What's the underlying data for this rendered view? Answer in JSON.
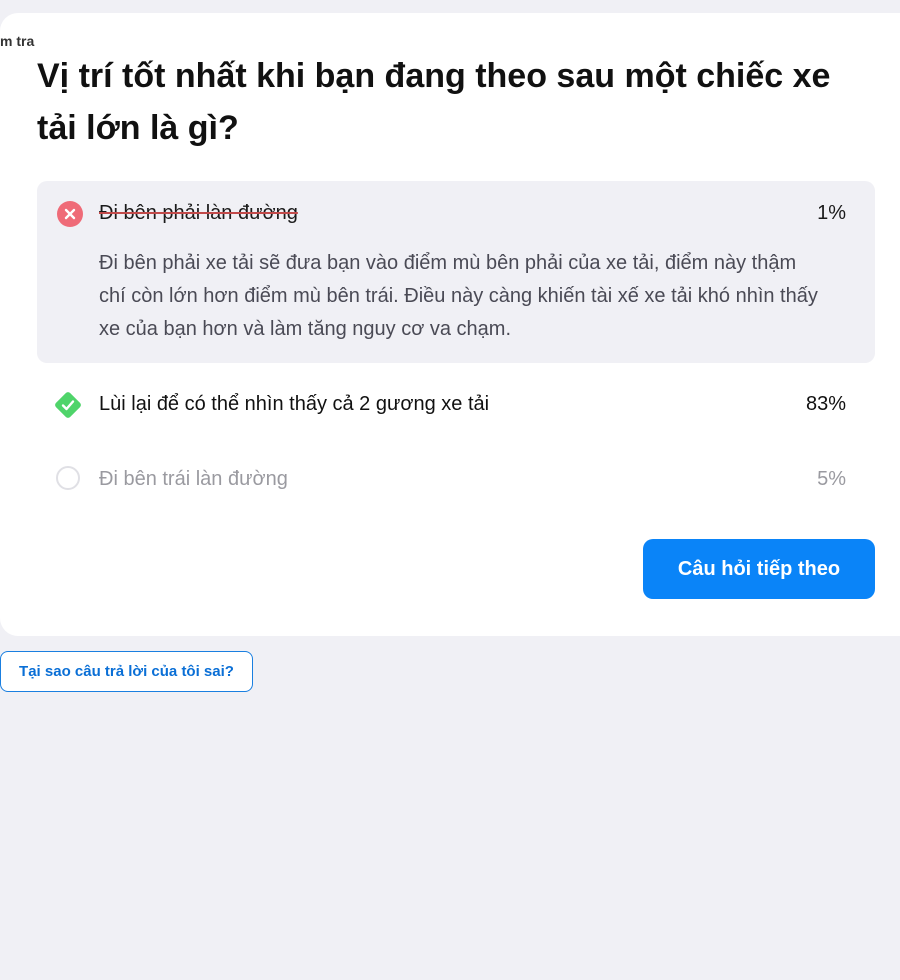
{
  "breadcrumb": "m tra",
  "question": "Vị trí tốt nhất khi bạn đang theo sau một chiếc xe tải lớn là gì?",
  "answers": [
    {
      "label": "Đi bên phải làn đường",
      "percent": "1%",
      "state": "wrong",
      "icon": "x-circle-icon",
      "explanation": "Đi bên phải xe tải sẽ đưa bạn vào điểm mù bên phải của xe tải, điểm này thậm chí còn lớn hơn điểm mù bên trái. Điều này càng khiến tài xế xe tải khó nhìn thấy xe của bạn hơn và làm tăng nguy cơ va chạm."
    },
    {
      "label": "Lùi lại để có thể nhìn thấy cả 2 gương xe tải",
      "percent": "83%",
      "state": "correct",
      "icon": "check-diamond-icon"
    },
    {
      "label": "Đi bên trái làn đường",
      "percent": "5%",
      "state": "neutral",
      "icon": "empty-circle-icon"
    }
  ],
  "next_button_label": "Câu hỏi tiếp theo",
  "why_wrong_label": "Tại sao câu trả lời của tôi sai?",
  "colors": {
    "page_background": "#f0f0f5",
    "card_background": "#ffffff",
    "wrong_answer_background": "#f0f0f5",
    "wrong_icon": "#ef6b78",
    "correct_icon": "#4fd46a",
    "primary_button": "#0a84f8",
    "link_button_text": "#0a6fd6"
  }
}
